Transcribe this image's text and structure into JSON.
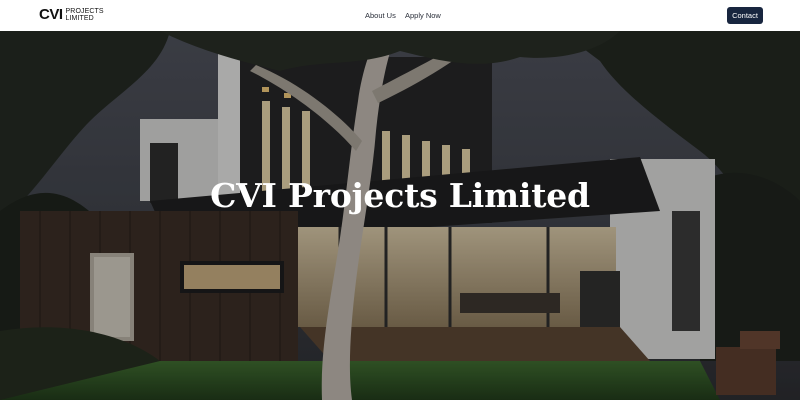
{
  "header": {
    "logo_mark": "CVI",
    "logo_line1": "PROJECTS",
    "logo_line2": "LIMITED",
    "nav": [
      {
        "label": "About Us"
      },
      {
        "label": "Apply Now"
      }
    ],
    "contact_label": "Contact"
  },
  "hero": {
    "title": "CVI Projects Limited",
    "image_subject": "modern house at dusk with large tree"
  },
  "colors": {
    "contact_button": "#18263f",
    "header_bg": "#ffffff",
    "title_text": "#ffffff"
  }
}
